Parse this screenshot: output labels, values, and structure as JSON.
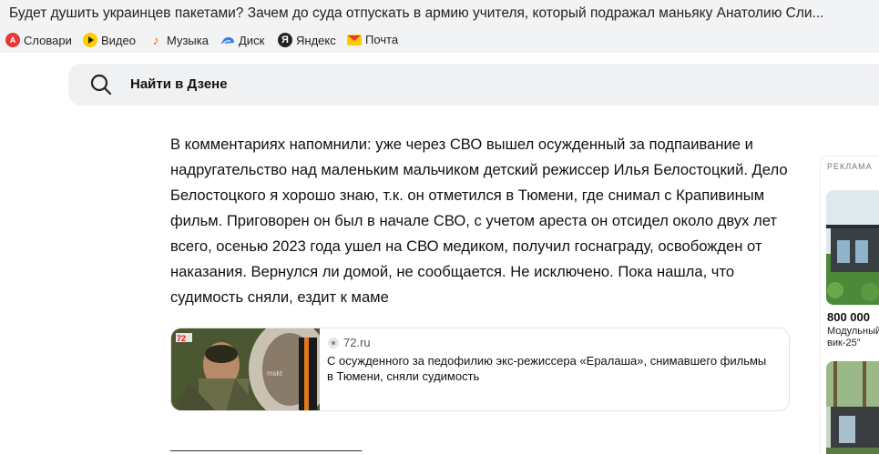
{
  "window": {
    "title": "Будет душить украинцев пакетами? Зачем до суда отпускать в армию учителя, который подражал маньяку Анатолию Сли..."
  },
  "bookmarks": [
    {
      "label": "Словари",
      "icon": "dictionary-icon"
    },
    {
      "label": "Видео",
      "icon": "video-play-icon"
    },
    {
      "label": "Музыка",
      "icon": "music-note-icon"
    },
    {
      "label": "Диск",
      "icon": "disk-cloud-icon"
    },
    {
      "label": "Яндекс",
      "icon": "yandex-logo-icon"
    },
    {
      "label": "Почта",
      "icon": "mail-envelope-icon"
    }
  ],
  "search": {
    "placeholder": "Найти в Дзене",
    "icon": "search-icon"
  },
  "article": {
    "paragraph": "В комментариях напомнили: уже через СВО вышел осужденный за подпаивание и надругательство над маленьким мальчиком детский режиссер Илья Белостоцкий. Дело Белостоцкого я хорошо знаю, т.к. он отметился в Тюмени, где снимал с Крапивиным фильм. Приговорен он был в начале СВО, с учетом ареста он отсидел около двух лет всего, осенью 2023 года ушел на СВО медиком, получил госнаграду, освобожден от наказания. Вернулся ли домой, не сообщается. Не исключено. Пока нашла, что судимость сняли, ездит к маме",
    "separator": "___________________________"
  },
  "link_card": {
    "source": "72.ru",
    "title": "С осужденного за педофилию экс-режиссера «Ералаша», снимавшего фильмы в Тюмени, сняли судимость",
    "thumb_watermark": "72",
    "thumb_badge": "mskt"
  },
  "ad": {
    "label": "РЕКЛАМА",
    "price": "800 000",
    "desc_line1": "Модульный",
    "desc_line2": "вик-25\""
  },
  "colors": {
    "chrome_bg": "#f2f3f5",
    "search_bg": "#f0f1f3",
    "text": "#111111"
  }
}
